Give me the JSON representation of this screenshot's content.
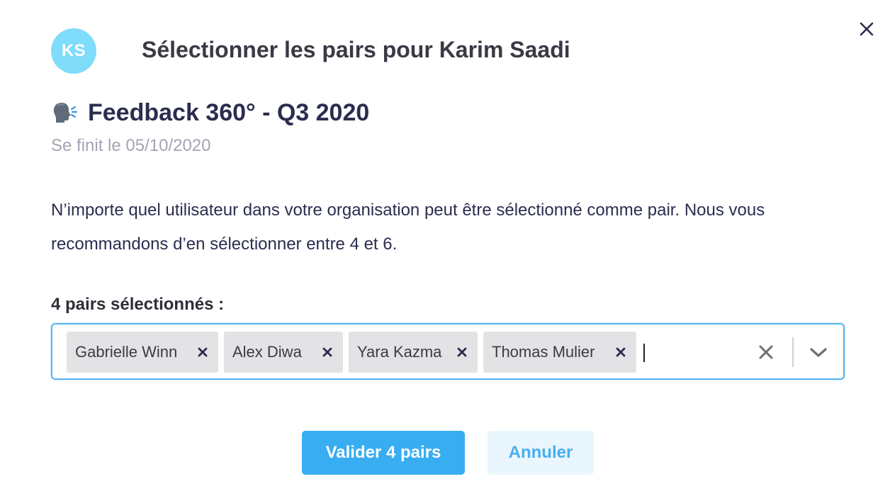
{
  "header": {
    "avatar_initials": "KS",
    "avatar_color": "#7fdcfb",
    "title": "Sélectionner les pairs pour Karim Saadi",
    "close_icon": "close-icon"
  },
  "campaign": {
    "icon": "speaking-head-icon",
    "name": "Feedback 360° - Q3 2020",
    "end_date": "Se finit le 05/10/2020"
  },
  "description": "N’importe quel utilisateur dans votre organisation peut être sélectionné comme pair. Nous vous recommandons d’en sélectionner entre 4 et 6.",
  "selection": {
    "label": "4 pairs sélectionnés :",
    "chips": [
      {
        "label": "Gabrielle Winn"
      },
      {
        "label": "Alex Diwa"
      },
      {
        "label": "Yara Kazma"
      },
      {
        "label": "Thomas Mulier"
      }
    ],
    "focus_color": "#5bb5f0"
  },
  "actions": {
    "confirm_label": "Valider 4 pairs",
    "cancel_label": "Annuler",
    "primary_color": "#38adf2"
  }
}
